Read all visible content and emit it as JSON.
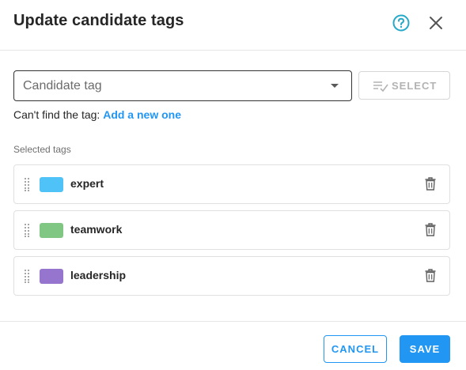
{
  "dialog": {
    "title": "Update candidate tags",
    "help_icon": "help-circle-icon",
    "close_icon": "close-icon"
  },
  "picker": {
    "placeholder": "Candidate tag",
    "select_button_label": "SELECT",
    "select_button_icon": "list-check-icon",
    "select_button_enabled": false
  },
  "hint": {
    "text": "Can't find the tag:",
    "link": "Add a new one"
  },
  "selected": {
    "label": "Selected tags",
    "tags": [
      {
        "name": "expert",
        "color": "#4fc3f7"
      },
      {
        "name": "teamwork",
        "color": "#81c784"
      },
      {
        "name": "leadership",
        "color": "#9575cd"
      }
    ]
  },
  "footer": {
    "cancel_label": "CANCEL",
    "save_label": "SAVE"
  },
  "colors": {
    "accent": "#2196f3",
    "help_icon": "#26a9c9"
  }
}
